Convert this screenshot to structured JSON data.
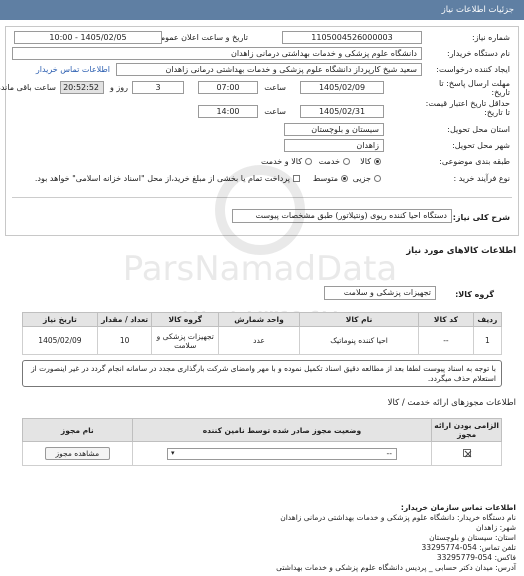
{
  "header": {
    "title": "جزئیات اطلاعات نیاز"
  },
  "need": {
    "number_label": "شماره نیاز:",
    "number_value": "1105004526000003",
    "announce_label": "تاریخ و ساعت اعلان عمومی:",
    "announce_value": "1405/02/05 - 10:00",
    "buyer_label": "نام دستگاه خریدار:",
    "buyer_value": "دانشگاه علوم پزشکی و خدمات بهداشتی درمانی زاهدان",
    "creator_label": "ایجاد کننده درخواست:",
    "creator_value": "سعید شیخ کارپرداز دانشگاه علوم پزشکی و خدمات بهداشتی درمانی زاهدان",
    "contact_link": "اطلاعات تماس خریدار",
    "deadline_label": "مهلت ارسال پاسخ: تا تاریخ:",
    "deadline_date": "1405/02/09",
    "time_label": "ساعت",
    "deadline_time": "07:00",
    "days_value": "3",
    "days_label": "روز و",
    "remaining_time": "20:52:52",
    "remaining_label": "ساعت باقی مانده",
    "validity_label": "حداقل تاریخ اعتبار قیمت: تا تاریخ:",
    "validity_date": "1405/02/31",
    "validity_time": "14:00",
    "province_label": "استان محل تحویل:",
    "province_value": "سیستان و بلوچستان",
    "city_label": "شهر محل تحویل:",
    "city_value": "زاهدان",
    "category_label": "طبقه بندی موضوعی:",
    "category_options": [
      "کالا",
      "خدمت",
      "کالا و خدمت"
    ],
    "purchase_label": "نوع فرآیند خرید :",
    "purchase_options": [
      "جزیی",
      "متوسط"
    ],
    "payment_note": "پرداخت تمام یا بخشی از مبلغ خرید،از محل \"اسناد خزانه اسلامی\" خواهد بود."
  },
  "description": {
    "label": "شرح کلی نیاز:",
    "value": "دستگاه احیا کننده ریوی (ونتیلاتور) طبق مشخصات پیوست"
  },
  "goods": {
    "section_title": "اطلاعات کالاهای مورد نیاز",
    "group_label": "گروه کالا:",
    "group_value": "تجهیزات پزشکی و سلامت",
    "columns": [
      "ردیف",
      "کد کالا",
      "نام کالا",
      "واحد شمارش",
      "گروه کالا",
      "تعداد / مقدار",
      "تاریخ نیاز"
    ],
    "rows": [
      [
        "1",
        "--",
        "احیا کننده پنوماتیک",
        "عدد",
        "تجهیزات پزشکی و سلامت",
        "10",
        "1405/02/09"
      ]
    ],
    "note": "با توجه به اسناد پیوست لطفا بعد از مطالعه دقیق اسناد تکمیل نموده و با مهر وامضای شرکت بارگذاری مجدد در سامانه انجام گردد در غیر اینصورت از استعلام حذف میگردد."
  },
  "licenses": {
    "section_title": "اطلاعات مجوزهای ارائه خدمت / کالا",
    "columns": [
      "الزامی بودن ارائه مجوز",
      "وضعیت مجوز صادر شده توسط نامین کننده",
      "نام مجوز"
    ],
    "status_value": "--",
    "view_button": "مشاهده مجوز"
  },
  "buyer_contact": {
    "section_title": "اطلاعات تماس سازمان خریدار:",
    "name_line": "نام دستگاه خریدار: دانشگاه علوم پزشکی و خدمات بهداشتی درمانی زاهدان",
    "city_line": "شهر: زاهدان",
    "province_line": "استان: سیستان و بلوچستان",
    "phone_line": "تلفن تماس: 054-33295774",
    "fax_line": "فاکس: 054-33295779",
    "address_line": "آدرس: میدان دکتر حسابی _ پردیس دانشگاه علوم پزشکی و خدمات بهداشتی"
  },
  "watermark": {
    "lines": [
      "ParsNamadData",
      "۰۲۱-۸۸۳۴۹۶۷۰"
    ]
  },
  "colors": {
    "header_bg": "#5f7fa3",
    "link": "#2a5db0"
  }
}
